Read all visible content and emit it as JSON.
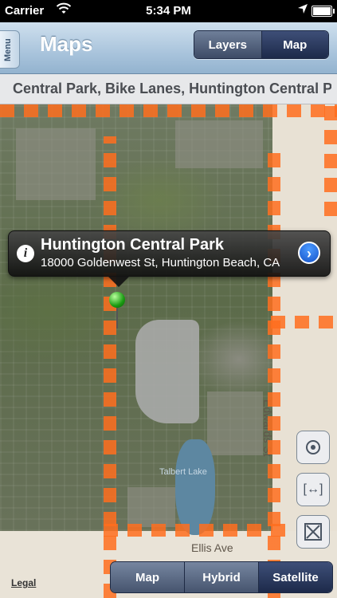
{
  "status_bar": {
    "carrier": "Carrier",
    "time": "5:34 PM"
  },
  "navbar": {
    "menu_label": "Menu",
    "title": "Maps",
    "segments": [
      {
        "label": "Layers"
      },
      {
        "label": "Map"
      }
    ]
  },
  "header": {
    "title": "Central Park, Bike Lanes, Huntington Central Park"
  },
  "map": {
    "labels": {
      "street_right": "Edwards St",
      "street_bottom": "Ellis Ave",
      "lake": "Talbert Lake"
    },
    "callout": {
      "title": "Huntington Central Park",
      "subtitle": "18000 Goldenwest St, Huntington Beach, CA"
    },
    "bike_lane_color": "#ff6e1e",
    "pin_color": "#1a9b12"
  },
  "controls": {
    "locate_icon": "locate-icon",
    "fit_icon": "fit-bounds-icon",
    "clear_icon": "clear-icon"
  },
  "footer": {
    "legal": "Legal",
    "map_types": [
      {
        "label": "Map"
      },
      {
        "label": "Hybrid"
      },
      {
        "label": "Satellite"
      }
    ],
    "selected": "Satellite"
  }
}
